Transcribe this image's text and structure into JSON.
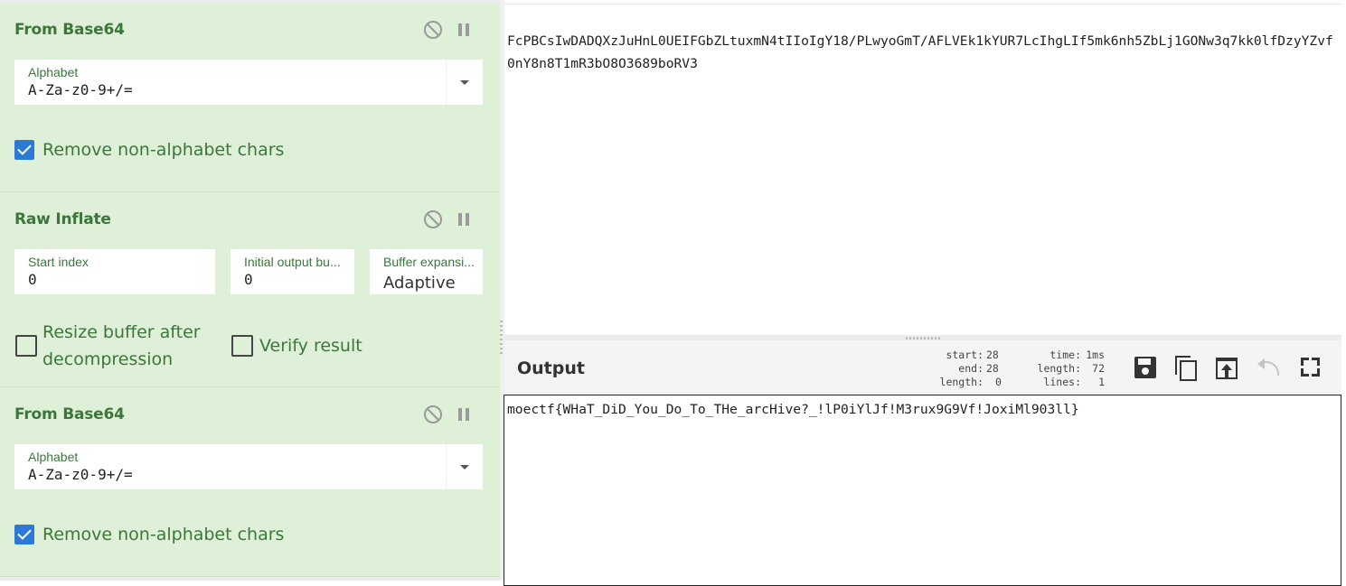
{
  "recipe": {
    "operations": [
      {
        "title": "From Base64",
        "alphabet_label": "Alphabet",
        "alphabet_value": "A-Za-z0-9+/=",
        "remove_non_alphabet_label": "Remove non-alphabet chars",
        "remove_non_alphabet_checked": true
      },
      {
        "title": "Raw Inflate",
        "start_index_label": "Start index",
        "start_index_value": "0",
        "initial_output_label": "Initial output bu...",
        "initial_output_value": "0",
        "buffer_expansion_label": "Buffer expansi...",
        "buffer_expansion_value": "Adaptive",
        "resize_buffer_label": "Resize buffer after decompression",
        "resize_buffer_checked": false,
        "verify_result_label": "Verify result",
        "verify_result_checked": false
      },
      {
        "title": "From Base64",
        "alphabet_label": "Alphabet",
        "alphabet_value": "A-Za-z0-9+/=",
        "remove_non_alphabet_label": "Remove non-alphabet chars",
        "remove_non_alphabet_checked": true
      }
    ],
    "icons": [
      "disable-icon",
      "pause-icon"
    ]
  },
  "input": {
    "text": "FcPBCsIwDADQXzJuHnL0UEIFGbZLtuxmN4tIIoIgY18/PLwyoGmT/AFLVEk1kYUR7LcIhgLIf5mk6nh5ZbLj1GONw3q7kk0lfDzyYZvf0nY8n8T1mR3bO8O3689boRV3"
  },
  "output": {
    "title": "Output",
    "stats": {
      "start_label": "start:",
      "start": "28",
      "end_label": "end:",
      "end": "28",
      "sel_length_label": "length:",
      "sel_length": "0",
      "time_label": "time:",
      "time": "1ms",
      "length_label": "length:",
      "length": "72",
      "lines_label": "lines:",
      "lines": "1"
    },
    "toolbar_icons": [
      "save-icon",
      "copy-icon",
      "replace-input-icon",
      "undo-icon",
      "maximise-icon"
    ],
    "text": "moectf{WHaT_DiD_You_Do_To_THe_arcHive?_!lP0iYlJf!M3rux9G9Vf!JoxiMl903ll}"
  },
  "colors": {
    "operation_bg": "#dff0d8",
    "operation_title": "#3c763d",
    "checkbox_on": "#2d7ad6"
  }
}
